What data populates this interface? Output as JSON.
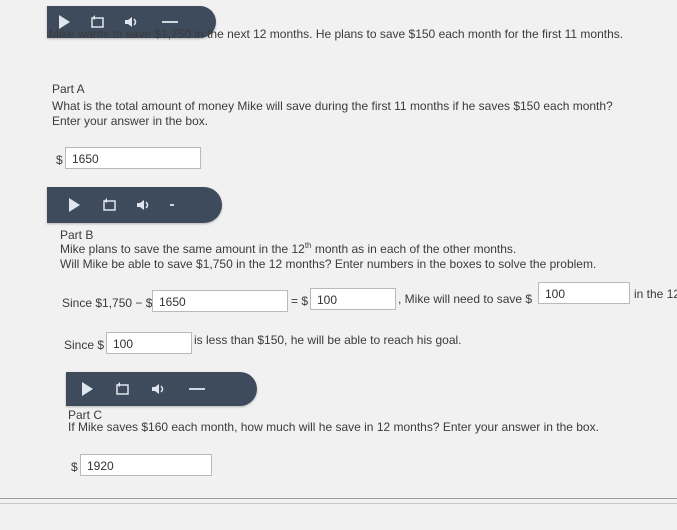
{
  "audio_players": [
    {
      "play": "play-icon",
      "replay": "replay-icon",
      "volume": "volume-icon",
      "extra": "minimize-icon"
    },
    {
      "play": "play-icon",
      "replay": "replay-icon",
      "volume": "volume-icon",
      "extra": "minimize-icon"
    },
    {
      "play": "play-icon",
      "replay": "replay-icon",
      "volume": "volume-icon",
      "extra": "minimize-icon"
    }
  ],
  "intro": "Mike wants to save $1,750 in the next 12 months. He plans to save $150 each month for the first 11 months.",
  "part_a": {
    "label": "Part A",
    "question": "What is the total amount of money Mike will save during the first 11 months if he saves $150 each month?",
    "instruction": "Enter your answer in the box.",
    "currency": "$",
    "answer": "1650"
  },
  "part_b": {
    "label": "Part B",
    "line1_pre": "Mike plans to save the same amount in the 12",
    "line1_sup": "th",
    "line1_post": " month as in each of the other months.",
    "line2": "Will Mike be able to save $1,750 in the 12 months? Enter numbers in the boxes to solve the problem.",
    "row1": {
      "since_text": "Since $1,750 − $",
      "box1": "1650",
      "equals_text": "= $",
      "box2": "100",
      "mid_text": ", Mike will need to save $",
      "box3": "100",
      "tail_text": "in the 12"
    },
    "row2": {
      "since_text": "Since $",
      "box": "100",
      "tail_text": "is less than $150, he will be able to reach his goal."
    }
  },
  "part_c": {
    "label": "Part C",
    "question": "If Mike saves $160 each month, how much will he save in 12 months? Enter your answer in the box.",
    "currency": "$",
    "answer": "1920"
  }
}
